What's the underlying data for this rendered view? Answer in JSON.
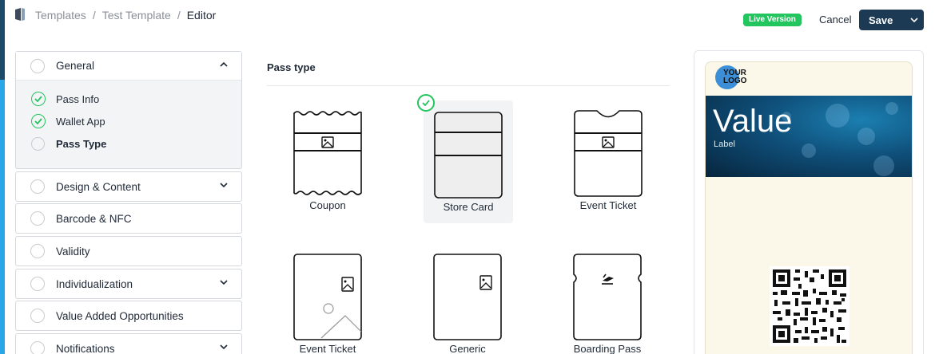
{
  "header": {
    "breadcrumb": [
      "Templates",
      "Test Template",
      "Editor"
    ],
    "separator": "/",
    "live_badge": "Live Version",
    "cancel": "Cancel",
    "save": "Save"
  },
  "steps": {
    "general": "General",
    "sub_items": [
      {
        "label": "Pass Info",
        "done": true
      },
      {
        "label": "Wallet App",
        "done": true
      },
      {
        "label": "Pass Type",
        "done": false,
        "current": true
      }
    ],
    "items": [
      {
        "label": "Design & Content",
        "expandable": true
      },
      {
        "label": "Barcode & NFC",
        "expandable": false
      },
      {
        "label": "Validity",
        "expandable": false
      },
      {
        "label": "Individualization",
        "expandable": true
      },
      {
        "label": "Value Added Opportunities",
        "expandable": false
      },
      {
        "label": "Notifications",
        "expandable": true
      }
    ]
  },
  "pass_type": {
    "title": "Pass type",
    "selected": "Store Card",
    "options": [
      "Coupon",
      "Store Card",
      "Event Ticket",
      "Event Ticket",
      "Generic",
      "Boarding Pass"
    ]
  },
  "preview": {
    "logo_line1": "YOUR",
    "logo_line2": "LOGO",
    "value": "Value",
    "label": "Label"
  },
  "colors": {
    "accent_green": "#22c55e",
    "save_bg": "#1d3a55",
    "pass_bg": "#fbf7e9"
  }
}
